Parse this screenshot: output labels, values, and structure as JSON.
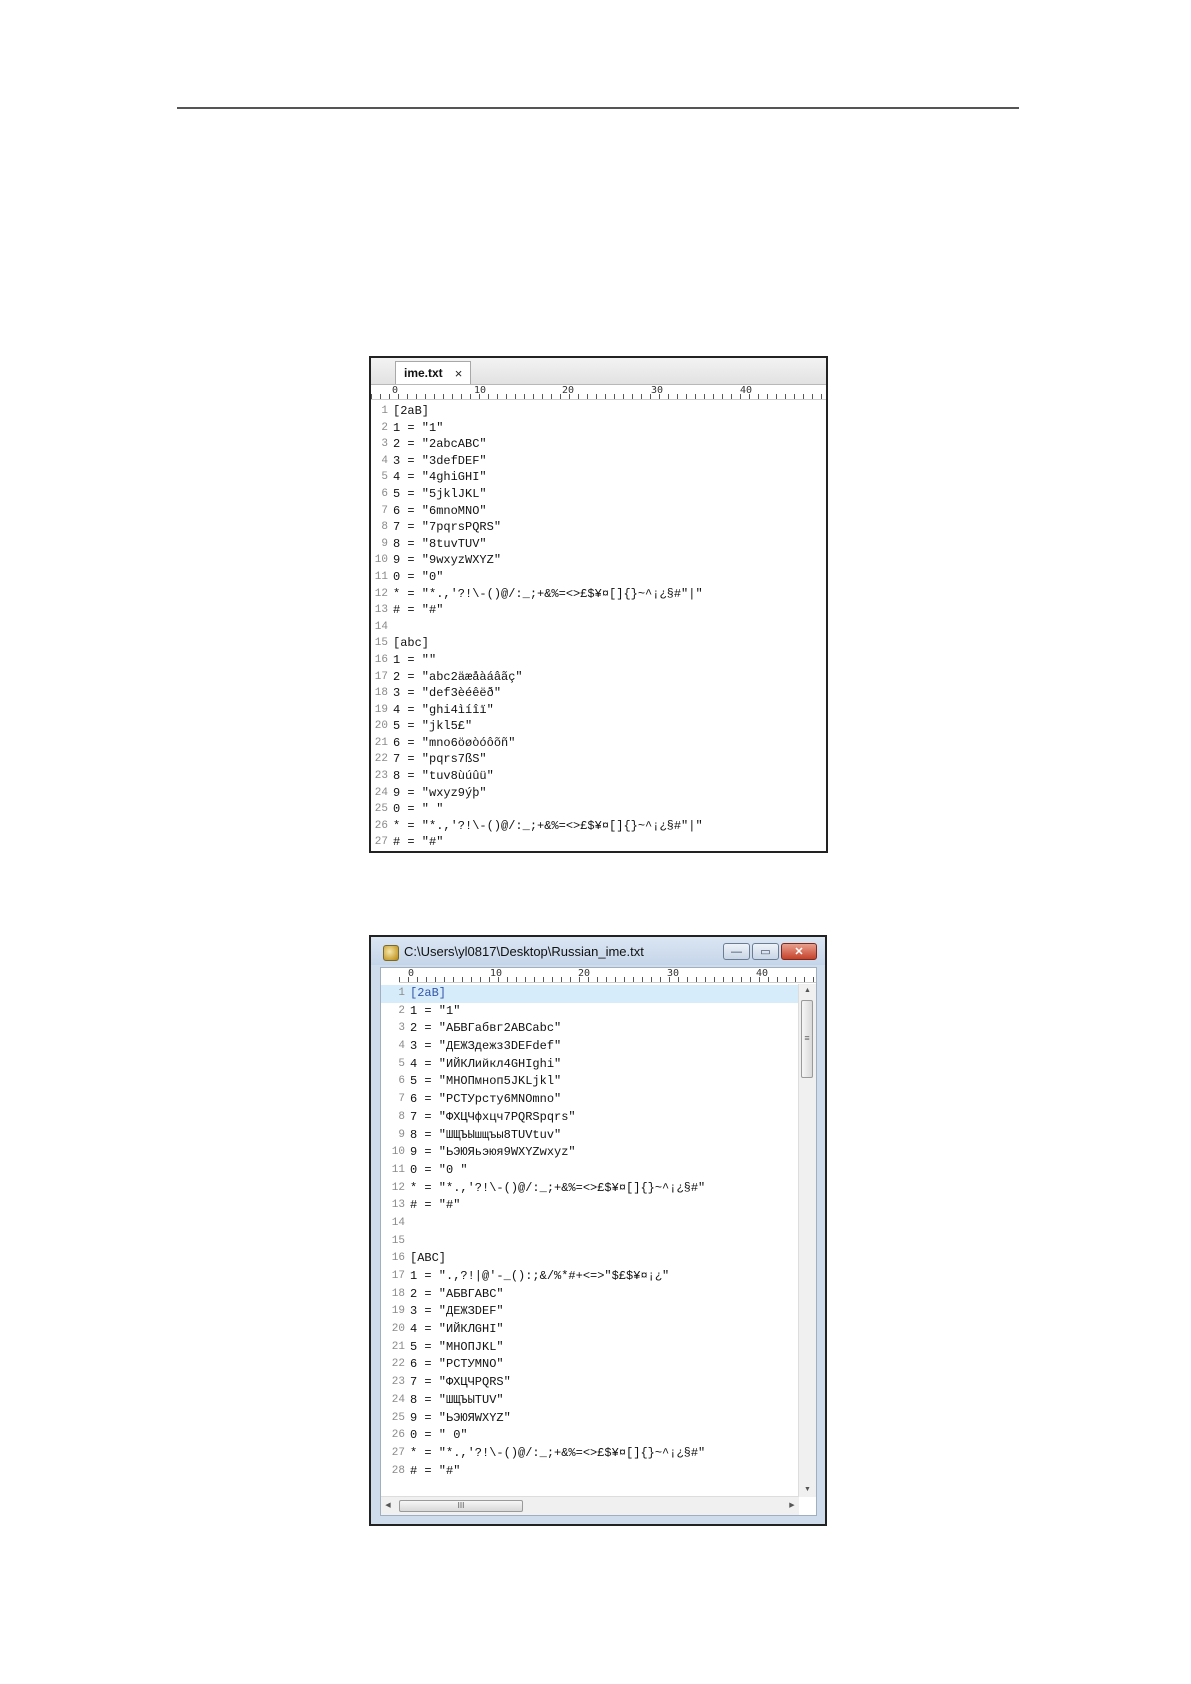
{
  "editor1": {
    "tab": {
      "title": "ime.txt",
      "close_glyph": "×"
    },
    "ruler": [
      "0",
      "10",
      "20",
      "30",
      "40"
    ],
    "lines": [
      {
        "n": "1",
        "text": "[2aB]"
      },
      {
        "n": "2",
        "text": "1 = \"1\""
      },
      {
        "n": "3",
        "text": "2 = \"2abcABC\""
      },
      {
        "n": "4",
        "text": "3 = \"3defDEF\""
      },
      {
        "n": "5",
        "text": "4 = \"4ghiGHI\""
      },
      {
        "n": "6",
        "text": "5 = \"5jklJKL\""
      },
      {
        "n": "7",
        "text": "6 = \"6mnoMNO\""
      },
      {
        "n": "8",
        "text": "7 = \"7pqrsPQRS\""
      },
      {
        "n": "9",
        "text": "8 = \"8tuvTUV\""
      },
      {
        "n": "10",
        "text": "9 = \"9wxyzWXYZ\""
      },
      {
        "n": "11",
        "text": "0 = \"0\""
      },
      {
        "n": "12",
        "text": "* = \"*.,'?!\\-()@/:_;+&%=<>£$¥¤[]{}~^¡¿§#\"|\""
      },
      {
        "n": "13",
        "text": "# = \"#\""
      },
      {
        "n": "14",
        "text": ""
      },
      {
        "n": "15",
        "text": "[abc]"
      },
      {
        "n": "16",
        "text": "1 = \"\""
      },
      {
        "n": "17",
        "text": "2 = \"abc2äæåàáâãç\""
      },
      {
        "n": "18",
        "text": "3 = \"def3èéêëð\""
      },
      {
        "n": "19",
        "text": "4 = \"ghi4ìíîï\""
      },
      {
        "n": "20",
        "text": "5 = \"jkl5£\""
      },
      {
        "n": "21",
        "text": "6 = \"mno6öøòóôõñ\""
      },
      {
        "n": "22",
        "text": "7 = \"pqrs7ßS\""
      },
      {
        "n": "23",
        "text": "8 = \"tuv8ùúûü\""
      },
      {
        "n": "24",
        "text": "9 = \"wxyz9ýþ\""
      },
      {
        "n": "25",
        "text": "0 = \" \""
      },
      {
        "n": "26",
        "text": "* = \"*.,'?!\\-()@/:_;+&%=<>£$¥¤[]{}~^¡¿§#\"|\""
      },
      {
        "n": "27",
        "text": "# = \"#\""
      }
    ]
  },
  "editor2": {
    "window": {
      "title": "C:\\Users\\yl0817\\Desktop\\Russian_ime.txt",
      "minimize_glyph": "—",
      "maximize_glyph": "▭",
      "close_glyph": "✕"
    },
    "ruler": [
      "0",
      "10",
      "20",
      "30",
      "40"
    ],
    "lines": [
      {
        "n": "1",
        "text": "[2aB]"
      },
      {
        "n": "2",
        "text": "1 = \"1\""
      },
      {
        "n": "3",
        "text": "2 = \"АБВГабвг2ABCabc\""
      },
      {
        "n": "4",
        "text": "3 = \"ДЕЖЗдежз3DEFdef\""
      },
      {
        "n": "5",
        "text": "4 = \"ИЙКЛийкл4GHIghi\""
      },
      {
        "n": "6",
        "text": "5 = \"МНОПмноп5JKLjkl\""
      },
      {
        "n": "7",
        "text": "6 = \"РСТУрсту6MNOmno\""
      },
      {
        "n": "8",
        "text": "7 = \"ФХЦЧфхцч7PQRSpqrs\""
      },
      {
        "n": "9",
        "text": "8 = \"ШЩЪЫшщъы8TUVtuv\""
      },
      {
        "n": "10",
        "text": "9 = \"ЬЭЮЯьэюя9WXYZwxyz\""
      },
      {
        "n": "11",
        "text": "0 = \"0 \""
      },
      {
        "n": "12",
        "text": "* = \"*.,'?!\\-()@/:_;+&%=<>£$¥¤[]{}~^¡¿§#\""
      },
      {
        "n": "13",
        "text": "# = \"#\""
      },
      {
        "n": "14",
        "text": ""
      },
      {
        "n": "15",
        "text": ""
      },
      {
        "n": "16",
        "text": "[ABC]"
      },
      {
        "n": "17",
        "text": "1 = \".,?!|@'-_():;&/%*#+<=>\"$£$¥¤¡¿\""
      },
      {
        "n": "18",
        "text": "2 = \"АБВГABC\""
      },
      {
        "n": "19",
        "text": "3 = \"ДЕЖЗDEF\""
      },
      {
        "n": "20",
        "text": "4 = \"ИЙКЛGHI\""
      },
      {
        "n": "21",
        "text": "5 = \"МНОПJKL\""
      },
      {
        "n": "22",
        "text": "6 = \"РСТУMNO\""
      },
      {
        "n": "23",
        "text": "7 = \"ФХЦЧPQRS\""
      },
      {
        "n": "24",
        "text": "8 = \"ШЩЪЫTUV\""
      },
      {
        "n": "25",
        "text": "9 = \"ЬЭЮЯWXYZ\""
      },
      {
        "n": "26",
        "text": "0 = \" 0\""
      },
      {
        "n": "27",
        "text": "* = \"*.,'?!\\-()@/:_;+&%=<>£$¥¤[]{}~^¡¿§#\""
      },
      {
        "n": "28",
        "text": "# = \"#\""
      }
    ],
    "highlighted_line": 1,
    "scroll": {
      "up_glyph": "▲",
      "down_glyph": "▼",
      "left_glyph": "◀",
      "right_glyph": "▶",
      "v_grip": "≡",
      "h_grip": "III"
    }
  }
}
